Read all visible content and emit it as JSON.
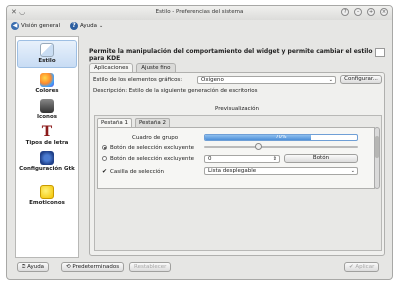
{
  "window": {
    "title": "Estilo - Preferencias del sistema",
    "controls": [
      "help-icon",
      "minimize-icon",
      "maximize-icon",
      "close-icon"
    ]
  },
  "toolbar": {
    "overview_label": "Visión general",
    "help_label": "Ayuda"
  },
  "sidebar": {
    "items": [
      {
        "label": "Estilo",
        "icon": "style-icon",
        "active": true
      },
      {
        "label": "Colores",
        "icon": "colors-icon"
      },
      {
        "label": "Iconos",
        "icon": "icons-icon"
      },
      {
        "label": "Tipos de letra",
        "icon": "fonts-icon"
      },
      {
        "label": "Configuración Gtk",
        "icon": "gtk-icon"
      },
      {
        "label": "Emoticonos",
        "icon": "emoticons-icon"
      }
    ]
  },
  "main": {
    "heading": "Permite la manipulación del comportamiento del widget y permite cambiar el estilo para KDE",
    "tabs": [
      "Aplicaciones",
      "Ajuste fino"
    ],
    "style_label": "Estilo de los elementos gráficos:",
    "style_value": "Oxígeno",
    "configure_label": "Configurar...",
    "description": "Descripción: Estilo de la siguiente generación de escritorios",
    "preview_title": "Previsualización",
    "preview": {
      "tabs": [
        "Pestaña 1",
        "Pestaña 2"
      ],
      "group_label": "Cuadro de grupo",
      "progress_value": 70,
      "progress_text": "70%",
      "slider_value": 0.35,
      "radio1_label": "Botón de selección excluyente",
      "radio2_label": "Botón de selección excluyente",
      "checkbox_label": "Casilla de selección",
      "spinbox_value": "0",
      "button_label": "Botón",
      "dropdown_label": "Lista desplegable"
    }
  },
  "footer": {
    "help_label": "Ayuda",
    "defaults_label": "Predeterminados",
    "reset_label": "Restablecer",
    "apply_label": "Aplicar"
  }
}
